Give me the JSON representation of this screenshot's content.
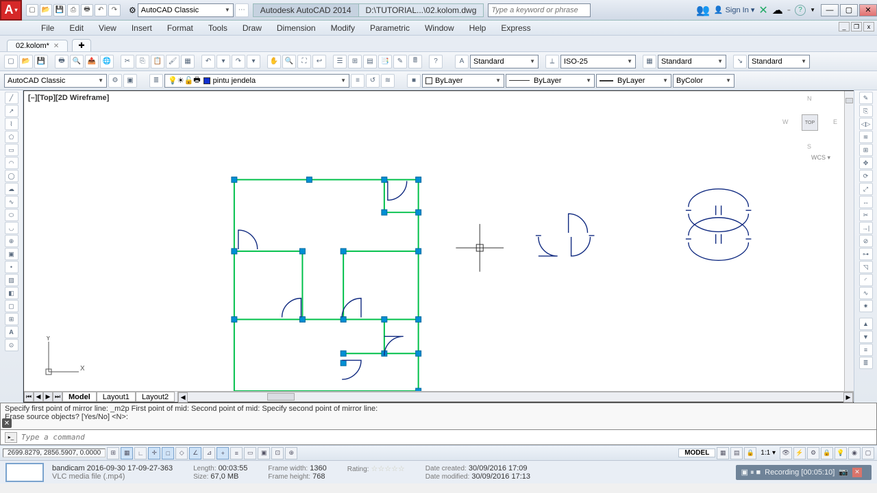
{
  "title": {
    "app": "Autodesk AutoCAD 2014",
    "file": "D:\\TUTORIAL...\\02.kolom.dwg",
    "search_placeholder": "Type a keyword or phrase",
    "signin": "Sign In"
  },
  "workspace": "AutoCAD Classic",
  "doc_tab": "02.kolom*",
  "menu": [
    "File",
    "Edit",
    "View",
    "Insert",
    "Format",
    "Tools",
    "Draw",
    "Dimension",
    "Modify",
    "Parametric",
    "Window",
    "Help",
    "Express"
  ],
  "row1": {
    "ws": "AutoCAD Classic",
    "layer": "pintu jendela",
    "dd": {
      "text": "Standard",
      "dim": "ISO-25",
      "tbl": "Standard",
      "ml": "Standard"
    }
  },
  "row2": {
    "ltype": "ByLayer",
    "lweight": "ByLayer",
    "plot": "ByLayer",
    "color": "ByColor"
  },
  "viewport_label": "[–][Top][2D Wireframe]",
  "viewcube": {
    "face": "TOP",
    "n": "N",
    "s": "S",
    "e": "E",
    "w": "W",
    "wcs": "WCS ▾"
  },
  "tabs": {
    "model": "Model",
    "l1": "Layout1",
    "l2": "Layout2"
  },
  "cmd": {
    "line1": "Specify first point of mirror line: _m2p First point of mid:   Second point of mid: Specify second point of mirror line:",
    "line2": "Erase source objects? [Yes/No] <N>:",
    "placeholder": "Type a command"
  },
  "status": {
    "coords": "2699.8279, 2856.5907, 0.0000",
    "model": "MODEL",
    "scale": "1:1 ▾"
  },
  "taskbar": {
    "name": "bandicam 2016-09-30 17-09-27-363",
    "type": "VLC media file (.mp4)",
    "length_k": "Length:",
    "length_v": "00:03:55",
    "size_k": "Size:",
    "size_v": "67,0 MB",
    "fw_k": "Frame width:",
    "fw_v": "1360",
    "fh_k": "Frame height:",
    "fh_v": "768",
    "rate_k": "Rating:",
    "dc_k": "Date created:",
    "dc_v": "30/09/2016 17:09",
    "dm_k": "Date modified:",
    "dm_v": "30/09/2016 17:13",
    "rec": "Recording  [00:05:10]"
  }
}
